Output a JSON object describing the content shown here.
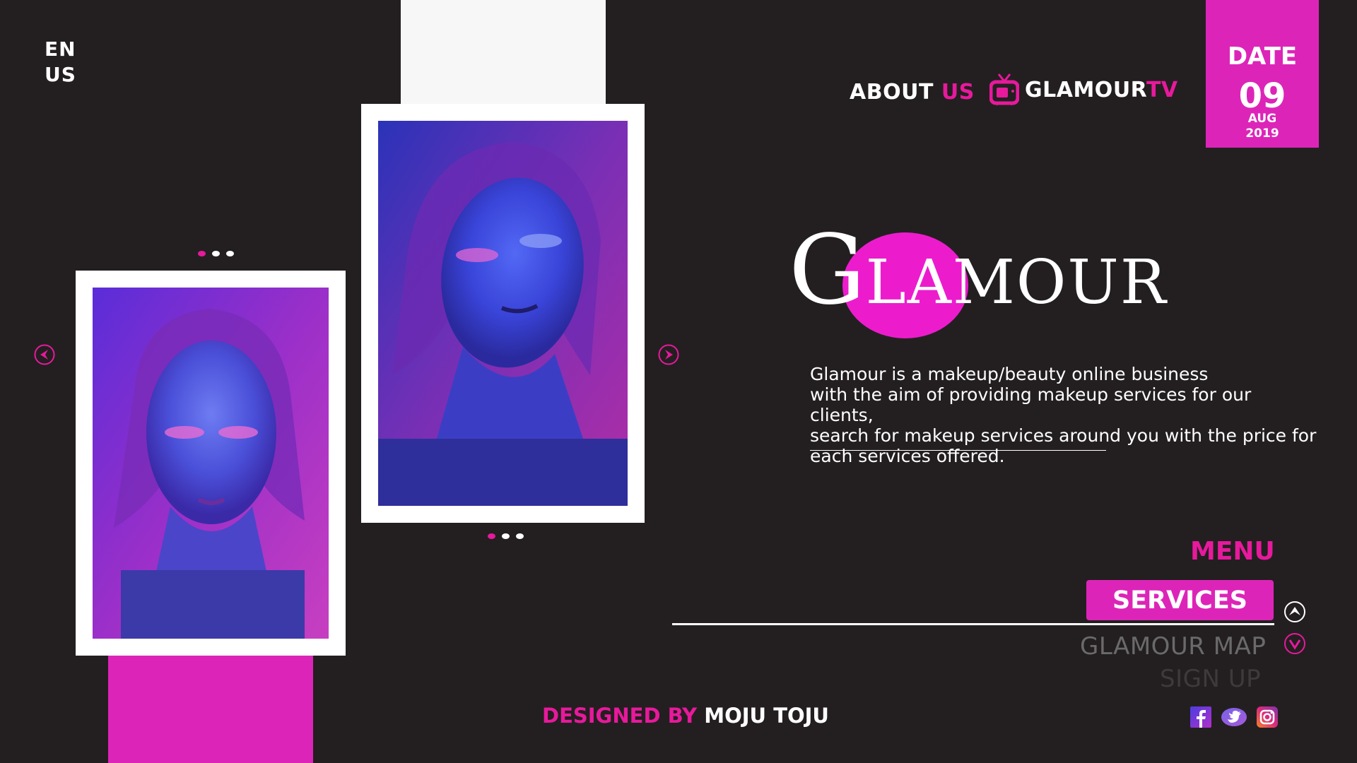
{
  "language": {
    "line1": "EN",
    "line2": "US"
  },
  "nav": {
    "about_prefix": "ABOUT",
    "about_accent": "US",
    "tv_prefix": "GLAMOUR",
    "tv_accent": "TV"
  },
  "date": {
    "label": "DATE",
    "day": "09",
    "month": "AUG",
    "year": "2019"
  },
  "logo": {
    "first_letter": "G",
    "rest": "LAMOUR"
  },
  "description": {
    "line1": "Glamour is a makeup/beauty online business",
    "line2": "with the aim of providing makeup services for our clients,",
    "line3": "search for makeup services around you with the price for",
    "line4": "each services offered."
  },
  "menu": {
    "title": "MENU",
    "items": [
      {
        "label": "SERVICES",
        "active": true
      },
      {
        "label": "GLAMOUR MAP",
        "active": false
      },
      {
        "label": "SIGN UP",
        "active": false
      }
    ]
  },
  "footer": {
    "designed_prefix": "DESIGNED BY",
    "designer": "MOJU TOJU"
  },
  "carousel_left": {
    "dots": 3,
    "active_dot": 1
  },
  "carousel_right": {
    "dots": 3,
    "active_dot": 1
  },
  "icons": {
    "tv": "tv-icon",
    "prev": "arrow-left-icon",
    "next": "arrow-right-icon",
    "up": "chevron-up-icon",
    "down": "chevron-down-icon",
    "social": [
      "facebook-icon",
      "twitter-icon",
      "instagram-icon"
    ]
  },
  "colors": {
    "background": "#231f20",
    "accent": "#e7199c",
    "accent_block": "#dc25b8",
    "muted": "#6a6a6a"
  }
}
